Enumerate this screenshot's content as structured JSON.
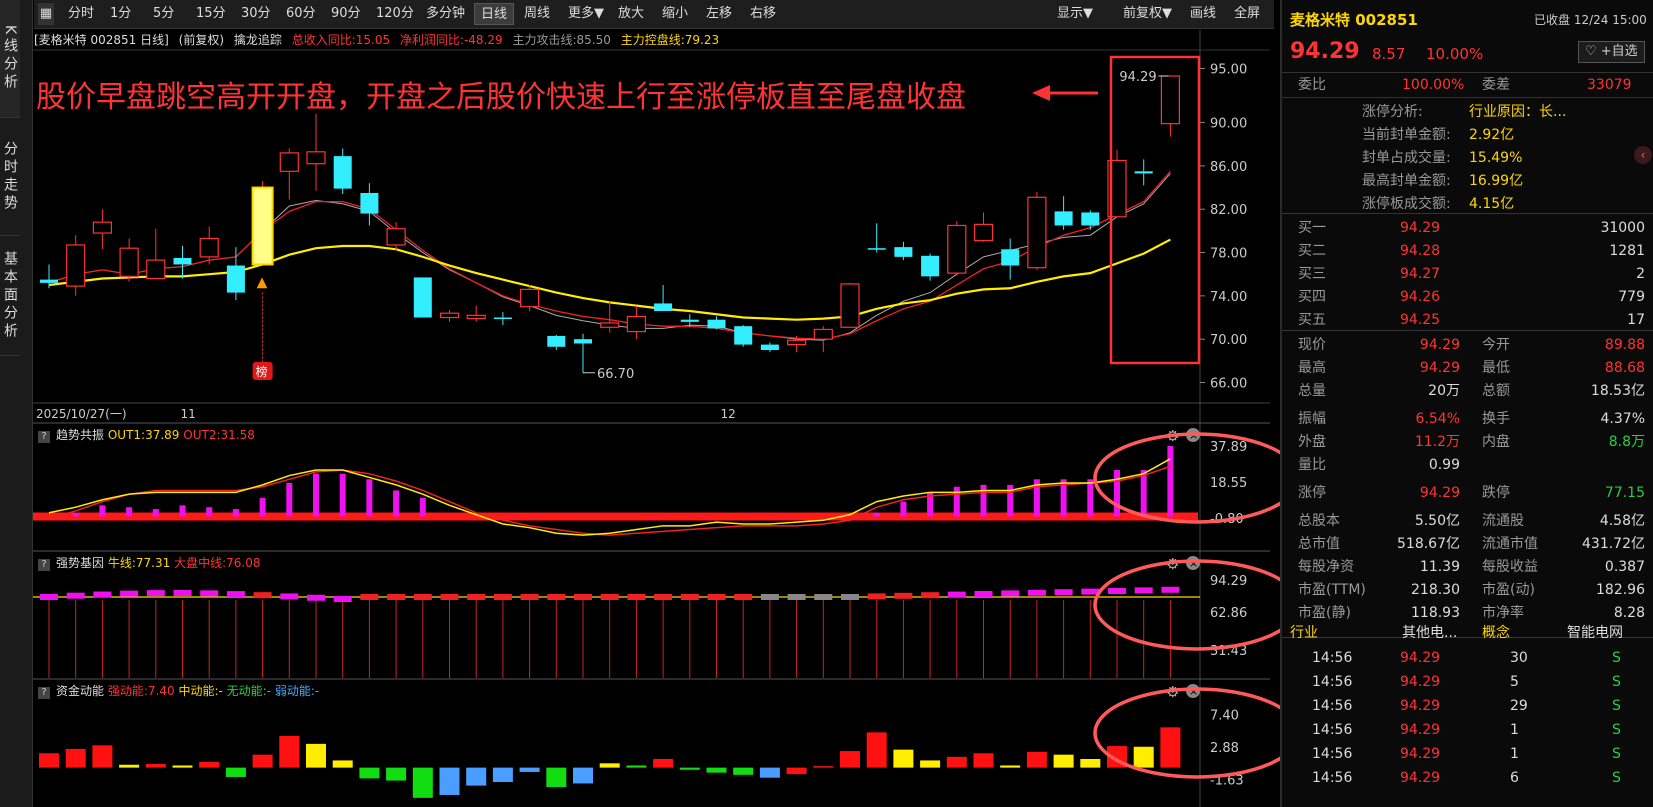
{
  "nav": {
    "kline": "K线分析",
    "fenshi": "分时走势",
    "jiben": "基本面分析"
  },
  "toolbar": {
    "periods": [
      "分时",
      "1分",
      "5分",
      "15分",
      "30分",
      "60分",
      "90分",
      "120分",
      "多分钟",
      "日线",
      "周线",
      "更多▼",
      "放大",
      "缩小",
      "左移",
      "右移"
    ],
    "active_period": "日线",
    "right": [
      "显示▼",
      "前复权▼",
      "画线",
      "全屏"
    ]
  },
  "info": {
    "stock": "[麦格米特 002851 日线]",
    "adj": "(前复权)",
    "indicator": "擒龙追踪",
    "rev": "总收入同比:15.05",
    "profit": "净利润同比:-48.29",
    "attack": "主力攻击线:85.50",
    "control": "主力控盘线:79.23"
  },
  "annotation": "股价早盘跳空高开开盘，开盘之后股价快速上行至涨停板直至尾盘收盘",
  "chart_data": {
    "type": "candlestick",
    "x_labels": [
      "2025/10/27(一)",
      "11",
      "12"
    ],
    "y_ticks": [
      "95.00",
      "90.00",
      "86.00",
      "82.00",
      "78.00",
      "74.00",
      "70.00",
      "66.00"
    ],
    "ylim": [
      64.2,
      96.7
    ],
    "candles": [
      [
        75.5,
        75.2,
        76.9,
        74.7
      ],
      [
        74.9,
        78.7,
        79.6,
        74.0
      ],
      [
        79.8,
        80.8,
        82.0,
        78.3
      ],
      [
        75.8,
        78.4,
        79.3,
        75.3
      ],
      [
        75.6,
        77.3,
        80.2,
        75.6
      ],
      [
        77.5,
        76.9,
        78.6,
        75.6
      ],
      [
        77.6,
        79.3,
        80.4,
        76.9
      ],
      [
        76.8,
        74.3,
        78.5,
        73.6
      ],
      [
        76.9,
        84.0,
        84.6,
        76.9
      ],
      [
        85.5,
        87.2,
        87.6,
        82.9
      ],
      [
        86.2,
        87.3,
        90.8,
        83.7
      ],
      [
        86.9,
        83.9,
        87.6,
        83.4
      ],
      [
        83.5,
        81.6,
        84.4,
        80.5
      ],
      [
        78.7,
        80.2,
        80.8,
        78.2
      ],
      [
        75.7,
        72.0,
        75.7,
        72.0
      ],
      [
        72.0,
        72.4,
        72.7,
        71.6
      ],
      [
        71.9,
        72.2,
        73.1,
        71.6
      ],
      [
        72.0,
        71.9,
        72.5,
        71.3
      ],
      [
        73.0,
        74.6,
        75.0,
        72.6
      ],
      [
        70.3,
        69.3,
        70.4,
        69.0
      ],
      [
        70.0,
        69.6,
        70.5,
        66.9
      ],
      [
        71.1,
        71.5,
        73.5,
        70.6
      ],
      [
        70.7,
        72.1,
        73.1,
        70.0
      ],
      [
        73.3,
        72.6,
        75.0,
        72.6
      ],
      [
        71.8,
        71.6,
        72.3,
        71.1
      ],
      [
        71.8,
        71.0,
        72.1,
        70.9
      ],
      [
        71.2,
        69.5,
        71.3,
        69.3
      ],
      [
        69.5,
        69.0,
        69.7,
        68.8
      ],
      [
        69.5,
        69.9,
        70.3,
        68.8
      ],
      [
        70.0,
        70.9,
        71.2,
        68.8
      ],
      [
        71.1,
        75.1,
        75.2,
        71.1
      ],
      [
        78.4,
        78.3,
        80.7,
        78.0
      ],
      [
        78.5,
        77.6,
        79.0,
        77.3
      ],
      [
        77.7,
        75.8,
        77.9,
        75.4
      ],
      [
        76.1,
        80.5,
        80.9,
        75.9
      ],
      [
        79.1,
        80.6,
        81.7,
        79.0
      ],
      [
        78.3,
        76.8,
        79.3,
        75.5
      ],
      [
        76.6,
        83.1,
        83.6,
        76.4
      ],
      [
        81.8,
        80.5,
        83.2,
        80.1
      ],
      [
        81.7,
        80.5,
        81.9,
        80.1
      ],
      [
        81.3,
        86.5,
        87.5,
        81.3
      ],
      [
        85.5,
        85.3,
        86.6,
        84.2
      ],
      [
        89.9,
        94.3,
        94.3,
        88.7
      ]
    ],
    "ma_white": [
      75.2,
      76.0,
      76.4,
      76.0,
      76.5,
      76.7,
      77.3,
      77.6,
      80.0,
      82.3,
      82.8,
      82.5,
      81.8,
      79.8,
      78.0,
      76.4,
      75.2,
      73.9,
      73.1,
      72.2,
      71.7,
      71.3,
      71.0,
      71.0,
      71.3,
      71.2,
      70.6,
      70.3,
      70.0,
      69.9,
      70.6,
      72.2,
      73.5,
      74.3,
      76.0,
      77.6,
      78.2,
      78.8,
      79.4,
      79.6,
      81.3,
      82.5,
      85.3
    ],
    "ma_red": [
      75.2,
      76.0,
      76.4,
      76.0,
      76.5,
      76.7,
      77.3,
      77.6,
      80.0,
      81.8,
      82.7,
      82.7,
      82.0,
      80.1,
      78.2,
      76.5,
      75.2,
      74.0,
      73.2,
      72.6,
      72.1,
      71.8,
      71.4,
      71.2,
      71.2,
      71.0,
      70.6,
      70.3,
      70.1,
      70.0,
      70.5,
      71.7,
      72.8,
      73.5,
      75.0,
      76.5,
      77.2,
      78.5,
      79.6,
      80.3,
      81.5,
      82.7,
      85.5
    ],
    "ma_yellow": [
      75.0,
      75.3,
      75.6,
      75.7,
      75.8,
      75.8,
      76.0,
      76.2,
      76.9,
      77.8,
      78.4,
      78.6,
      78.6,
      78.3,
      77.6,
      76.8,
      76.1,
      75.5,
      74.9,
      74.3,
      73.8,
      73.4,
      73.1,
      72.8,
      72.6,
      72.3,
      72.0,
      71.9,
      71.8,
      71.9,
      72.1,
      72.8,
      73.3,
      73.6,
      74.2,
      74.6,
      74.7,
      75.3,
      75.8,
      76.1,
      77.0,
      77.9,
      79.2
    ],
    "low_label": "66.70",
    "high_label": "94.29",
    "bang_label": "榜",
    "sub1": {
      "title": "趋势共振",
      "out1": "OUT1:37.89",
      "out2": "OUT2:31.58",
      "y_ticks": [
        "37.89",
        "18.55",
        "-0.80"
      ],
      "ylim": [
        -0.8,
        37.89
      ],
      "bars": [
        0,
        2,
        6,
        5,
        4,
        6,
        5,
        4,
        10,
        18,
        23,
        23,
        20,
        14,
        10,
        0,
        0,
        0,
        0,
        0,
        0,
        0,
        0,
        0,
        0,
        0,
        0,
        0,
        0,
        0,
        0,
        2,
        8,
        13,
        16,
        17,
        17,
        20,
        20,
        20,
        25,
        25,
        37.9
      ],
      "line1": [
        2,
        5,
        9,
        12,
        13,
        13,
        13,
        13,
        17,
        22,
        25,
        25,
        21,
        17,
        12,
        6,
        1,
        -4,
        -6,
        -9,
        -10,
        -9,
        -7,
        -5,
        -5,
        -3,
        -4,
        -4,
        -3,
        -2,
        1,
        8,
        11,
        13,
        13,
        14,
        14,
        17,
        18,
        18,
        20,
        23,
        31
      ],
      "line2": [
        -1,
        3,
        8,
        12,
        14,
        14,
        14,
        14,
        16,
        20,
        24,
        25,
        23,
        19,
        14,
        8,
        2,
        -2,
        -5,
        -7,
        -9,
        -10,
        -9,
        -8,
        -7,
        -6,
        -5,
        -5,
        -5,
        -4,
        -2,
        5,
        9,
        11,
        12,
        13,
        13,
        16,
        17,
        18,
        19,
        22,
        27
      ]
    },
    "sub2": {
      "title": "强势基因",
      "niu": "牛线:77.31",
      "dapan": "大盘中线:76.08",
      "y_ticks": [
        "94.29",
        "62.86",
        "31.43"
      ],
      "ylim": [
        0,
        100
      ]
    },
    "sub3": {
      "title": "资金动能",
      "strong": "强动能:7.40",
      "mid": "中动能:-",
      "none": "无动能:-",
      "weak": "弱动能:-",
      "y_ticks": [
        "7.40",
        "2.88",
        "-1.63"
      ],
      "ylim": [
        -4.5,
        9.4
      ],
      "bars": [
        2.0,
        2.6,
        3.1,
        0.4,
        0.5,
        0.3,
        0.8,
        -1.3,
        1.8,
        4.4,
        3.3,
        1.0,
        -1.5,
        -1.8,
        -4.2,
        -3.8,
        -2.5,
        -2.0,
        -0.6,
        -2.7,
        -2.2,
        0.6,
        0.3,
        1.2,
        -0.3,
        -0.7,
        -1.0,
        -1.4,
        -0.9,
        0.2,
        2.3,
        4.9,
        2.5,
        1.0,
        1.5,
        2.0,
        0.3,
        2.2,
        1.8,
        1.2,
        3.0,
        2.9,
        5.6
      ],
      "colors": [
        "red",
        "red",
        "red",
        "yellow",
        "red",
        "yellow",
        "red",
        "green",
        "red",
        "red",
        "yellow",
        "yellow",
        "green",
        "green",
        "green",
        "blue",
        "blue",
        "blue",
        "blue",
        "green",
        "blue",
        "yellow",
        "green",
        "red",
        "green",
        "green",
        "green",
        "blue",
        "red",
        "red",
        "red",
        "red",
        "yellow",
        "yellow",
        "red",
        "red",
        "yellow",
        "red",
        "yellow",
        "yellow",
        "red",
        "yellow",
        "red"
      ]
    }
  },
  "quote": {
    "name": "麦格米特 002851",
    "status": "已收盘 12/24 15:00",
    "price": "94.29",
    "change": "8.57",
    "pct": "10.00%",
    "add": "♡ +自选",
    "weibi_label": "委比",
    "weibi": "100.00%",
    "weicha_label": "委差",
    "weicha": "33079",
    "zt_rows": [
      [
        "涨停分析:",
        "行业原因：长..."
      ],
      [
        "当前封单金额:",
        "2.92亿"
      ],
      [
        "封单占成交量:",
        "15.49%"
      ],
      [
        "最高封单金额:",
        "16.99亿"
      ],
      [
        "涨停板成交额:",
        "4.15亿"
      ]
    ],
    "buys": [
      [
        "买一",
        "94.29",
        "31000"
      ],
      [
        "买二",
        "94.28",
        "1281"
      ],
      [
        "买三",
        "94.27",
        "2"
      ],
      [
        "买四",
        "94.26",
        "779"
      ],
      [
        "买五",
        "94.25",
        "17"
      ]
    ],
    "stats": [
      [
        "现价",
        "94.29",
        "今开",
        "89.88"
      ],
      [
        "最高",
        "94.29",
        "最低",
        "88.68"
      ],
      [
        "总量",
        "20万",
        "总额",
        "18.53亿"
      ],
      [
        "振幅",
        "6.54%",
        "换手",
        "4.37%"
      ],
      [
        "外盘",
        "11.2万",
        "内盘",
        "8.8万"
      ],
      [
        "量比",
        "0.99",
        "",
        ""
      ],
      [
        "涨停",
        "94.29",
        "跌停",
        "77.15"
      ],
      [
        "总股本",
        "5.50亿",
        "流通股",
        "4.58亿"
      ],
      [
        "总市值",
        "518.67亿",
        "流通市值",
        "431.72亿"
      ],
      [
        "每股净资",
        "11.39",
        "每股收益",
        "0.387"
      ],
      [
        "市盈(TTM)",
        "218.30",
        "市盈(动)",
        "182.96"
      ],
      [
        "市盈(静)",
        "118.93",
        "市净率",
        "8.28"
      ]
    ],
    "industry_label": "行业",
    "industry": "其他电...",
    "concept_label": "概念",
    "concept": "智能电网",
    "ticks": [
      [
        "14:56",
        "94.29",
        "30",
        "S"
      ],
      [
        "14:56",
        "94.29",
        "5",
        "S"
      ],
      [
        "14:56",
        "94.29",
        "29",
        "S"
      ],
      [
        "14:56",
        "94.29",
        "1",
        "S"
      ],
      [
        "14:56",
        "94.29",
        "1",
        "S"
      ],
      [
        "14:56",
        "94.29",
        "6",
        "S"
      ]
    ]
  }
}
